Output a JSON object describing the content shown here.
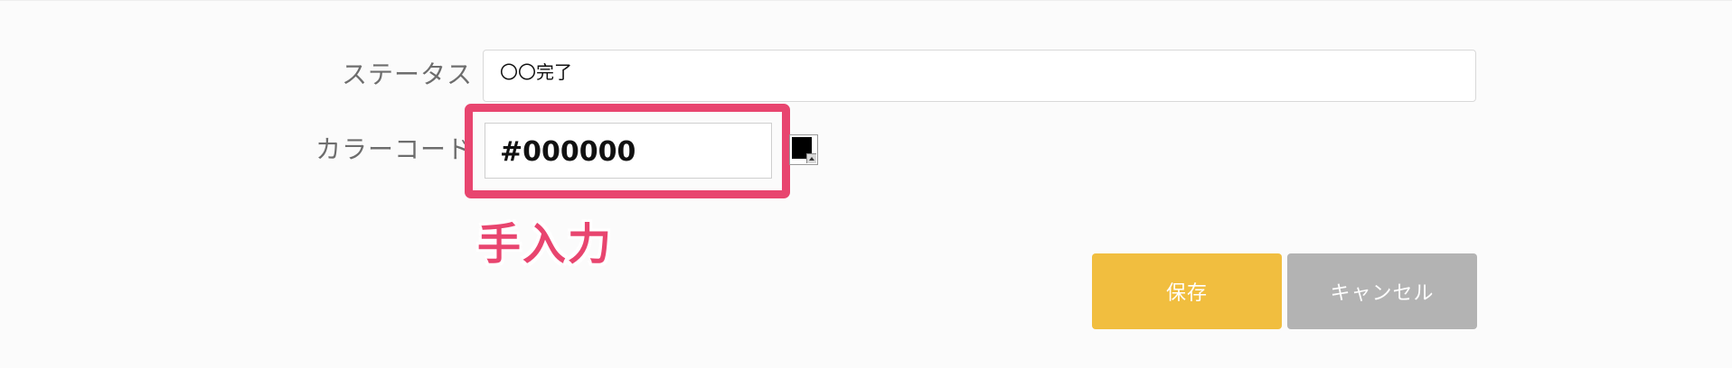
{
  "form": {
    "status_label": "ステータス",
    "status_value": "〇〇完了",
    "color_label": "カラーコード",
    "color_value": "#000000",
    "swatch_color": "#000000"
  },
  "annotation": {
    "text": "手入力",
    "color": "#e8456f"
  },
  "buttons": {
    "save_label": "保存",
    "save_color": "#f1be3f",
    "cancel_label": "キャンセル",
    "cancel_color": "#b3b3b3"
  }
}
